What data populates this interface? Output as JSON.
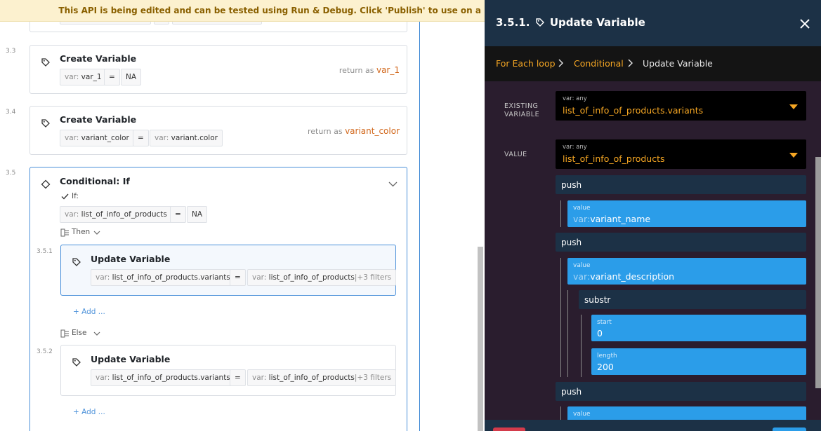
{
  "banner": {
    "text": "This API is being edited and can be tested using Run & Debug. Click 'Publish' to use on a"
  },
  "editor": {
    "step_3_3": {
      "num": "3.3",
      "title": "Create Variable",
      "var_key": "var:",
      "var_name": "var_1",
      "equals": "=",
      "value": "NA",
      "return_prefix": "return as",
      "return_var": "var_1"
    },
    "step_3_4": {
      "num": "3.4",
      "title": "Create Variable",
      "var_key": "var:",
      "var_name": "variant_color",
      "equals": "=",
      "value_key": "var:",
      "value_name": "variant.color",
      "return_prefix": "return as",
      "return_var": "variant_color"
    },
    "step_3_5": {
      "num": "3.5",
      "title": "Conditional: If",
      "if_label": "If:",
      "cond_key": "var:",
      "cond_name": "list_of_info_of_products",
      "equals": "=",
      "value": "NA",
      "then_label": "Then",
      "else_label": "Else",
      "add_label": "+ Add ...",
      "add_label_2": "+ Add ..."
    },
    "step_3_5_1": {
      "num": "3.5.1",
      "title": "Update Variable",
      "var_key": "var:",
      "var_name": "list_of_info_of_products.variants",
      "equals": "=",
      "value_key": "var:",
      "value_name": "list_of_info_of_products",
      "filters": "|+3 filters"
    },
    "step_3_5_2": {
      "num": "3.5.2",
      "title": "Update Variable",
      "var_key": "var:",
      "var_name": "list_of_info_of_products.variants",
      "equals": "=",
      "value_key": "var:",
      "value_name": "list_of_info_of_products",
      "filters": "|+3 filters"
    }
  },
  "drawer": {
    "title": "3.5.1.",
    "title_text": "Update Variable",
    "breadcrumb": [
      "For Each loop",
      "Conditional",
      "Update Variable"
    ],
    "existing": {
      "label_line1": "EXISTING",
      "label_line2": "VARIABLE",
      "type": "var: any",
      "value": "list_of_info_of_products.variants"
    },
    "value_field": {
      "label": "VALUE",
      "type": "var: any",
      "value": "list_of_info_of_products"
    },
    "ops": [
      {
        "label": "push",
        "value_title": "value",
        "value_key": "var:",
        "value_name": "variant_name"
      },
      {
        "label": "push",
        "value_title": "value",
        "value_key": "var:",
        "value_name": "variant_description",
        "sub_op": "substr",
        "start_title": "start",
        "start_value": "0",
        "length_title": "length",
        "length_value": "200"
      },
      {
        "label": "push",
        "value_title": "value"
      }
    ]
  },
  "colors": {
    "accent": "#f5a623",
    "drawer_header": "#1c3146",
    "drawer_bg": "#2a1d2e",
    "value_blue": "#2b9de9",
    "link_blue": "#4a90d9"
  }
}
